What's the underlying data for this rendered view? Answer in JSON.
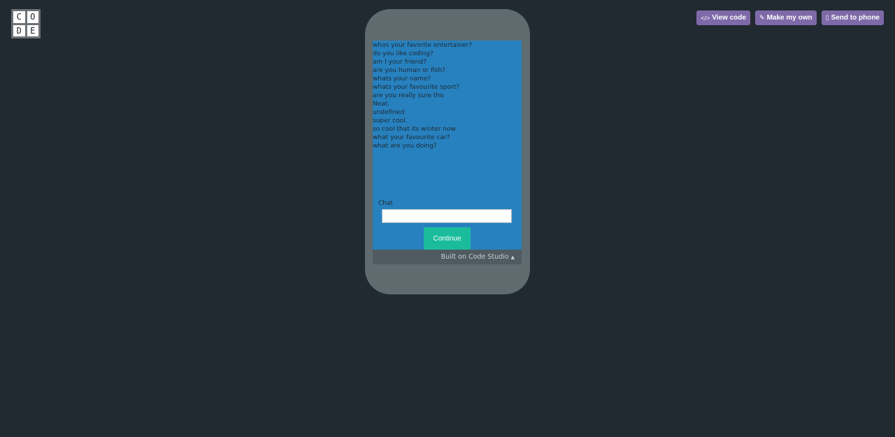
{
  "logo": {
    "letters": [
      "C",
      "O",
      "D",
      "E"
    ]
  },
  "actions": [
    {
      "label": "View code",
      "icon": "code-icon",
      "glyph": "</>"
    },
    {
      "label": "Make my own",
      "icon": "edit-icon",
      "glyph": "✎"
    },
    {
      "label": "Send to phone",
      "icon": "mobile-icon",
      "glyph": "▯"
    }
  ],
  "app": {
    "chat_log": [
      "whos your favorite entertainer?",
      "do you like coding?",
      "am I your friend?",
      "are you human or fish?",
      "whats your name?",
      "whats your favourite sport?",
      "are you really sure tho",
      "Neat.",
      "undefined",
      "super cool.",
      "so cool that its winter now",
      "what your favourite car?",
      "what are you doing?"
    ],
    "chat_label": "Chat",
    "chat_input_value": "",
    "continue_label": "Continue",
    "footer_text": "Built on Code Studio",
    "footer_caret": "▲"
  },
  "colors": {
    "background": "#222a31",
    "phone_frame": "#5e6b6f",
    "screen": "#2781bf",
    "action_button": "#7e6aa8",
    "continue_button": "#1abc9c"
  }
}
